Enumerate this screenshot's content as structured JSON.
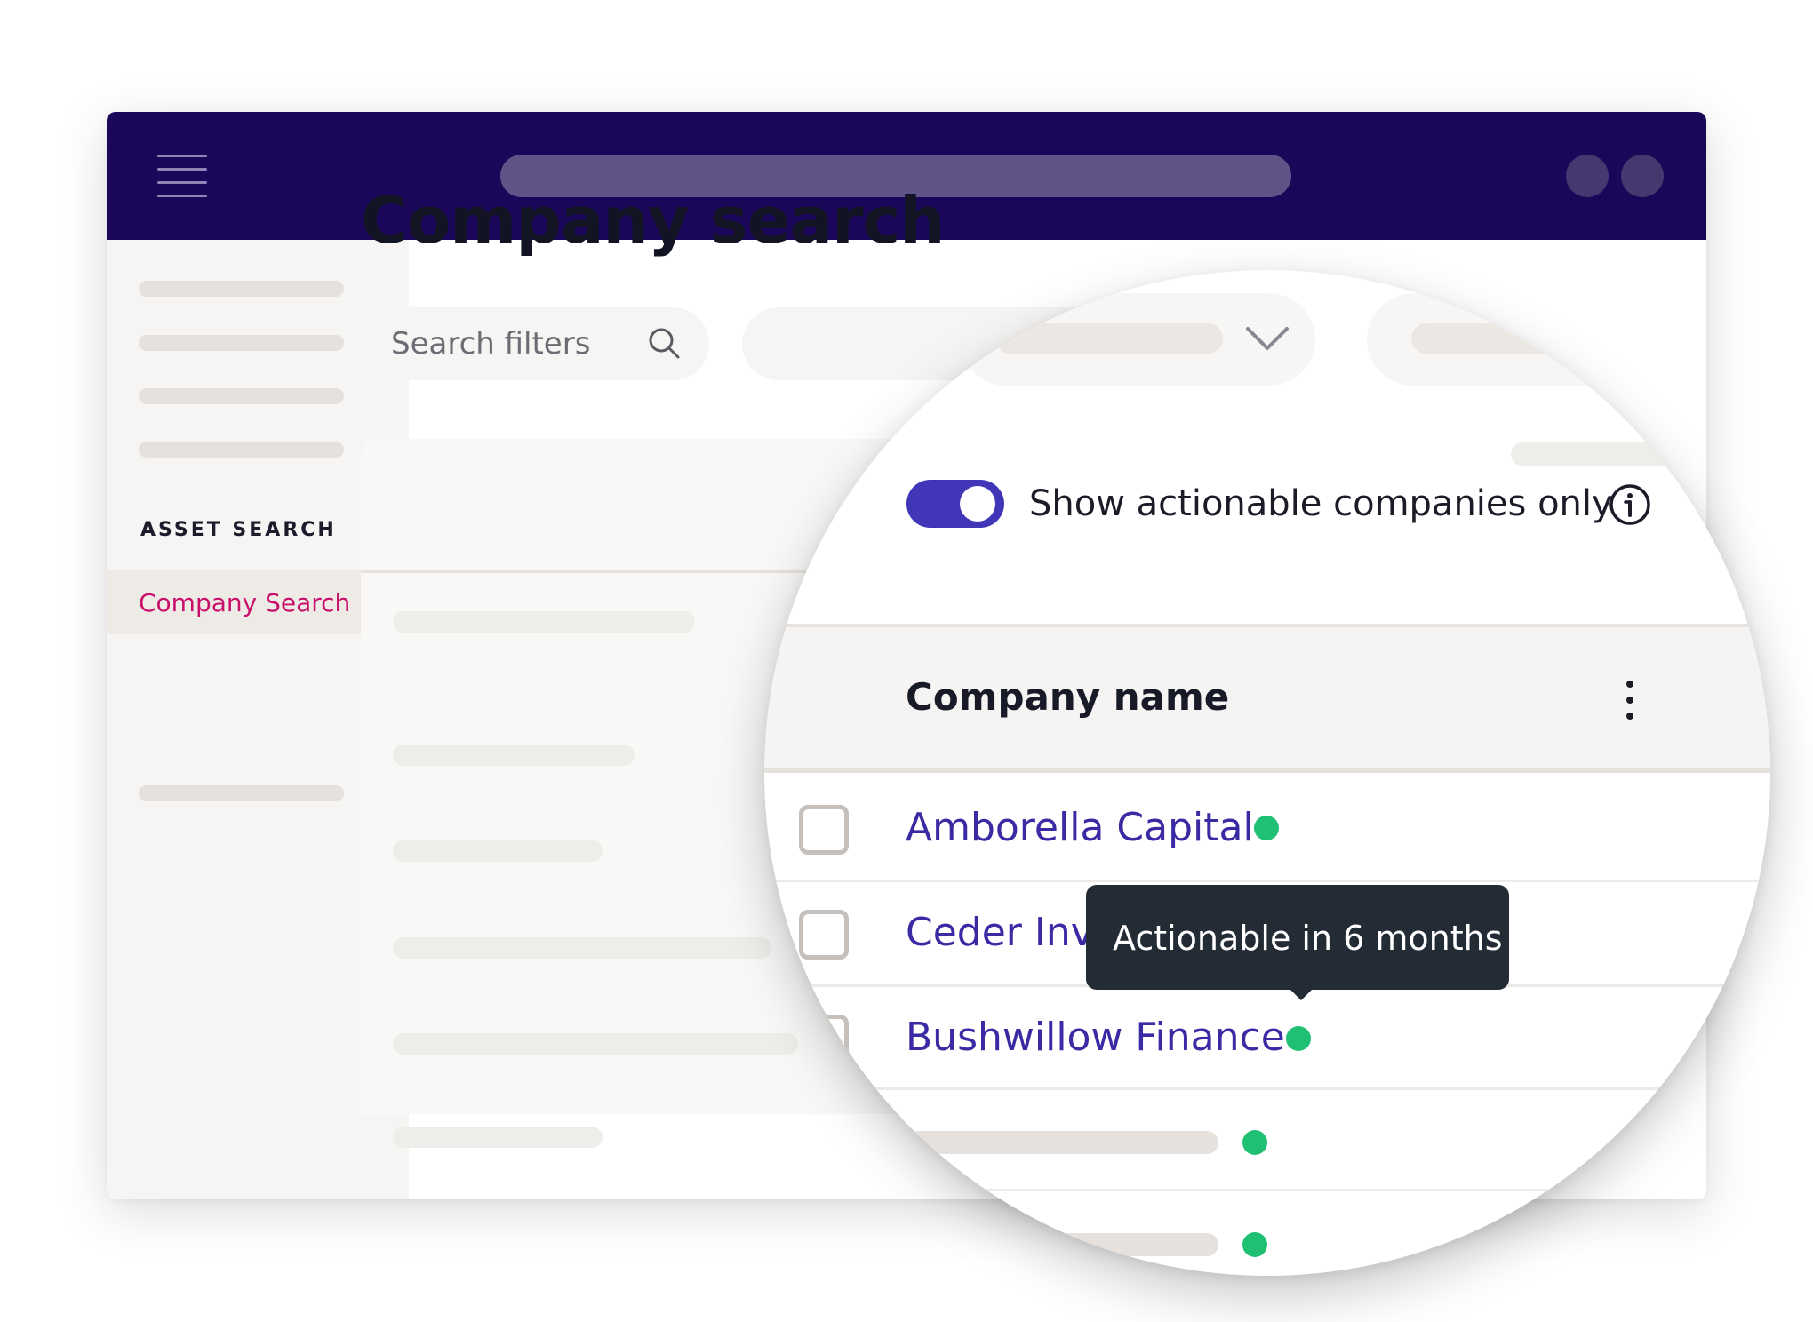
{
  "page": {
    "title": "Company search"
  },
  "sidebar": {
    "section_heading": "ASSET SEARCH",
    "active_item": "Company Search"
  },
  "search": {
    "placeholder": "Search filters"
  },
  "filter": {
    "toggle_label": "Show actionable companies only",
    "toggle_on": true
  },
  "table": {
    "column_header": "Company name",
    "rows": [
      {
        "name": "Amborella Capital",
        "status": "actionable"
      },
      {
        "name": "Ceder Inve",
        "status": "actionable"
      },
      {
        "name": "Bushwillow Finance",
        "status": "actionable"
      }
    ]
  },
  "tooltip": {
    "text": "Actionable in 6 months"
  },
  "icons": {
    "menu": "hamburger-icon",
    "search": "search-icon",
    "dropdown": "chevron-down-icon",
    "info": "info-icon",
    "column_menu": "kebab-icon"
  },
  "colors": {
    "topbar": "#1b0759",
    "accent": "#4135b8",
    "active_nav": "#c8106b",
    "link": "#3a2aa4",
    "status_actionable": "#20c074",
    "tooltip_bg": "#232c34"
  }
}
